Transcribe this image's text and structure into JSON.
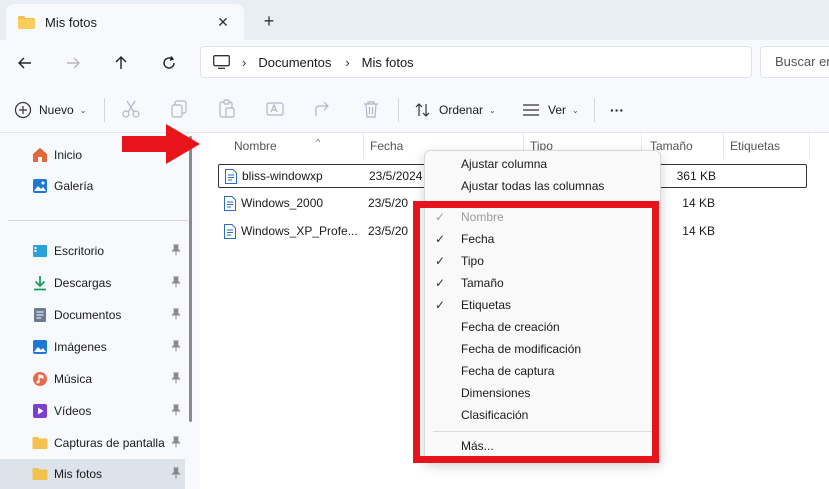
{
  "window": {
    "tab_title": "Mis fotos",
    "tab_close": "✕",
    "new_tab": "+"
  },
  "address": {
    "separator": "›",
    "crumbs": [
      "Documentos",
      "Mis fotos"
    ],
    "search_placeholder": "Buscar en"
  },
  "toolbar": {
    "new_label": "Nuevo",
    "sort_label": "Ordenar",
    "view_label": "Ver",
    "more_label": "···",
    "caret": "⌄"
  },
  "sidebar": {
    "items": [
      {
        "label": "Inicio",
        "icon": "home-icon"
      },
      {
        "label": "Galería",
        "icon": "gallery-icon"
      },
      {
        "label": "Escritorio",
        "icon": "desktop-icon"
      },
      {
        "label": "Descargas",
        "icon": "download-icon"
      },
      {
        "label": "Documentos",
        "icon": "documents-icon"
      },
      {
        "label": "Imágenes",
        "icon": "pictures-icon"
      },
      {
        "label": "Música",
        "icon": "music-icon"
      },
      {
        "label": "Vídeos",
        "icon": "videos-icon"
      },
      {
        "label": "Capturas de pantalla",
        "icon": "folder-icon"
      },
      {
        "label": "Mis fotos",
        "icon": "folder-icon"
      }
    ]
  },
  "table": {
    "columns": [
      "Nombre",
      "Fecha",
      "Tipo",
      "Tamaño",
      "Etiquetas"
    ],
    "sort_indicator": "^",
    "rows": [
      {
        "name": "bliss-windowxp",
        "date": "23/5/2024",
        "size": "361 KB"
      },
      {
        "name": "Windows_2000",
        "date": "23/5/20",
        "size": "14 KB"
      },
      {
        "name": "Windows_XP_Profe...",
        "date": "23/5/20",
        "size": "14 KB"
      }
    ]
  },
  "context_menu": {
    "fit_column": "Ajustar columna",
    "fit_all_columns": "Ajustar todas las columnas",
    "check": "✓",
    "columns": [
      {
        "label": "Nombre",
        "checked": true,
        "disabled": true
      },
      {
        "label": "Fecha",
        "checked": true,
        "disabled": false
      },
      {
        "label": "Tipo",
        "checked": true,
        "disabled": false
      },
      {
        "label": "Tamaño",
        "checked": true,
        "disabled": false
      },
      {
        "label": "Etiquetas",
        "checked": true,
        "disabled": false
      },
      {
        "label": "Fecha de creación",
        "checked": false,
        "disabled": false
      },
      {
        "label": "Fecha de modificación",
        "checked": false,
        "disabled": false
      },
      {
        "label": "Fecha de captura",
        "checked": false,
        "disabled": false
      },
      {
        "label": "Dimensiones",
        "checked": false,
        "disabled": false
      },
      {
        "label": "Clasificación",
        "checked": false,
        "disabled": false
      }
    ],
    "more": "Más..."
  },
  "colors": {
    "highlight": "#e8141c",
    "folder": "#f2c14e",
    "accent": "#0067c0"
  }
}
